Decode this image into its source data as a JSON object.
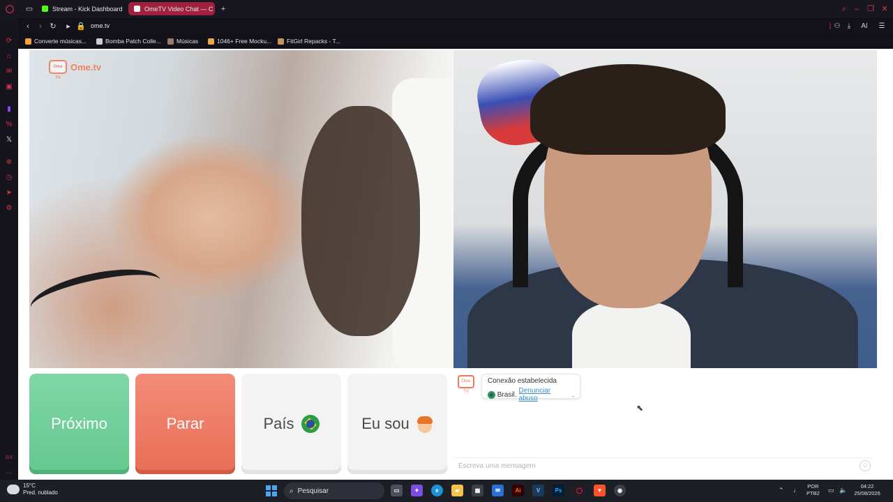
{
  "browser": {
    "tabs": [
      {
        "label": "Stream - Kick Dashboard",
        "icon": "kick-icon",
        "color": "#53fc18"
      },
      {
        "label": "OmeTV Video Chat — C",
        "icon": "ometv-icon",
        "color": "#a0213e"
      }
    ],
    "address": "ome.tv",
    "right_tools": {
      "ai_label": "AI"
    },
    "bookmarks": [
      {
        "label": "Converte músicas...",
        "color": "#f2a33a"
      },
      {
        "label": "Bomba Patch Colle...",
        "color": "#cccccc"
      },
      {
        "label": "Músicas",
        "color": "#9b7e6a"
      },
      {
        "label": "1046+ Free Mocku...",
        "color": "#e6a84a"
      },
      {
        "label": "FitGirl Repacks - T...",
        "color": "#c9955a"
      }
    ],
    "accent": "#d8324a"
  },
  "site": {
    "logo_text": "Ome.tv",
    "logo_badge": "Ome TV",
    "buttons": {
      "next": "Próximo",
      "stop": "Parar",
      "country": "País",
      "gender": "Eu sou"
    },
    "colors": {
      "next": "#6fcf97",
      "stop": "#ee7a63"
    }
  },
  "chat": {
    "status": "Conexão estabelecida",
    "country": "Brasil.",
    "report_link": "Denunciar abuso",
    "report_suffix": ".",
    "input_placeholder": "Escreva uma mensagem"
  },
  "taskbar": {
    "weather_temp": "15°C",
    "weather_desc": "Pred. nublado",
    "search_label": "Pesquisar",
    "lang": "POR",
    "layout": "PTB2",
    "time": "04:22",
    "date": "25/08/2026"
  }
}
